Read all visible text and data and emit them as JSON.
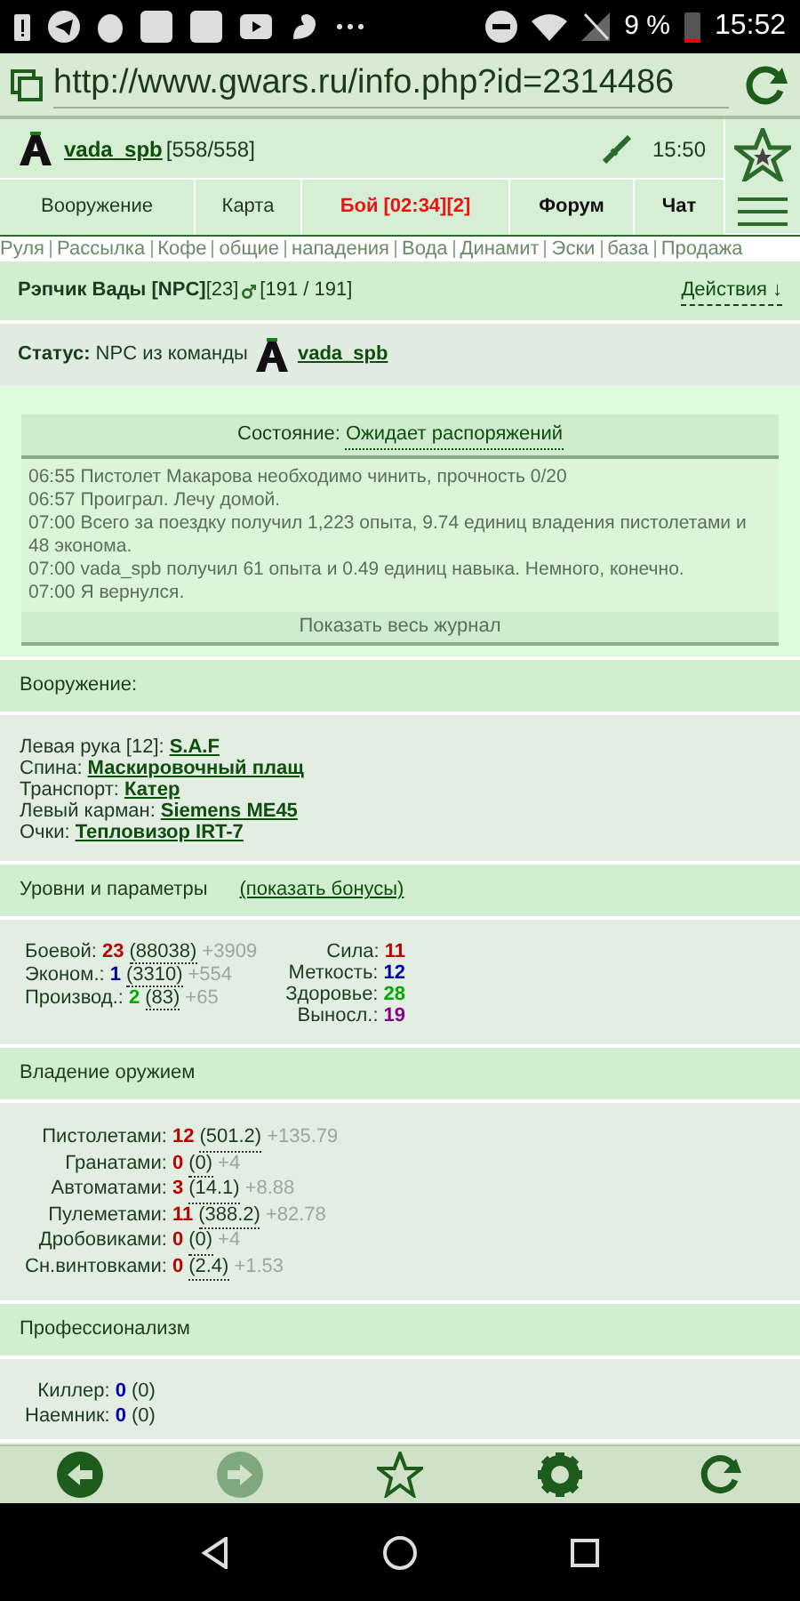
{
  "status_bar": {
    "battery": "9 %",
    "time": "15:52"
  },
  "browser": {
    "url": "http://www.gwars.ru/info.php?id=2314486"
  },
  "header": {
    "player": "vada_spb",
    "hp": "[558/558]",
    "time": "15:50"
  },
  "nav_tabs": [
    {
      "label": "Вооружение",
      "kind": "normal"
    },
    {
      "label": "Карта",
      "kind": "normal"
    },
    {
      "label": "Бой [02:34][2]",
      "kind": "alert"
    },
    {
      "label": "Форум",
      "kind": "bold"
    },
    {
      "label": "Чат",
      "kind": "bold"
    }
  ],
  "quick_links": [
    "Руля",
    "Рассылка",
    "Кофе",
    "общие",
    "нападения",
    "Вода",
    "Динамит",
    "Эски",
    "база",
    "Продажа"
  ],
  "npc": {
    "name": "Рэпчик Вады [NPC]",
    "level": "[23]",
    "hp": "[191 / 191]",
    "actions": "Действия ↓"
  },
  "status": {
    "label": "Статус:",
    "text": "NPC из команды",
    "team": "vada_spb"
  },
  "state": {
    "label": "Состояние:",
    "value": "Ожидает распоряжений",
    "show_log": "Показать весь журнал"
  },
  "log": [
    "06:55 Пистолет Макарова необходимо чинить, прочность 0/20",
    "06:57 Проиграл. Лечу домой.",
    "07:00 Всего за поездку получил 1,223 опыта, 9.74 единиц владения пистолетами и 48 эконома.",
    "07:00 vada_spb получил 61 опыта и 0.49 единиц навыка. Немного, конечно.",
    "07:00 Я вернулся."
  ],
  "equipment": {
    "title": "Вооружение:",
    "items": [
      {
        "slot": "Левая рука [12]:",
        "item": "S.A.F"
      },
      {
        "slot": "Спина:",
        "item": "Маскировочный плащ"
      },
      {
        "slot": "Транспорт:",
        "item": "Катер"
      },
      {
        "slot": "Левый карман:",
        "item": "Siemens ME45"
      },
      {
        "slot": "Очки:",
        "item": "Тепловизор IRT-7"
      }
    ]
  },
  "levels": {
    "title": "Уровни и параметры",
    "bonus_link": "(показать бонусы)",
    "rows": [
      {
        "label": "Боевой:",
        "level": "23",
        "exp": "(88038)",
        "bonus": "+3909",
        "color": "#bb0000"
      },
      {
        "label": "Эконом.:",
        "level": "1",
        "exp": "(3310)",
        "bonus": "+554",
        "color": "#0000aa"
      },
      {
        "label": "Производ.:",
        "level": "2",
        "exp": "(83)",
        "bonus": "+65",
        "color": "#00aa00"
      }
    ],
    "attributes": [
      {
        "label": "Сила:",
        "value": "11",
        "color": "#bb0000"
      },
      {
        "label": "Меткость:",
        "value": "12",
        "color": "#0000aa"
      },
      {
        "label": "Здоровье:",
        "value": "28",
        "color": "#00aa00"
      },
      {
        "label": "Выносл.:",
        "value": "19",
        "color": "#880088"
      }
    ]
  },
  "weapons": {
    "title": "Владение оружием",
    "rows": [
      {
        "label": "Пистолетами:",
        "level": "12",
        "exp": "(501.2)",
        "bonus": "+135.79"
      },
      {
        "label": "Гранатами:",
        "level": "0",
        "exp": "(0)",
        "bonus": "+4"
      },
      {
        "label": "Автоматами:",
        "level": "3",
        "exp": "(14.1)",
        "bonus": "+8.88"
      },
      {
        "label": "Пулеметами:",
        "level": "11",
        "exp": "(388.2)",
        "bonus": "+82.78"
      },
      {
        "label": "Дробовиками:",
        "level": "0",
        "exp": "(0)",
        "bonus": "+4"
      },
      {
        "label": "Сн.винтовками:",
        "level": "0",
        "exp": "(2.4)",
        "bonus": "+1.53"
      }
    ]
  },
  "professionalism": {
    "title": "Профессионализм",
    "rows": [
      {
        "label": "Киллер:",
        "value": "0",
        "exp": "(0)"
      },
      {
        "label": "Наемник:",
        "value": "0",
        "exp": "(0)"
      }
    ]
  },
  "toolbar": [
    {
      "kind": "back",
      "disabled": false
    },
    {
      "kind": "forward",
      "disabled": true
    },
    {
      "kind": "star",
      "disabled": false
    },
    {
      "kind": "settings",
      "disabled": false
    },
    {
      "kind": "reload",
      "disabled": false
    }
  ]
}
